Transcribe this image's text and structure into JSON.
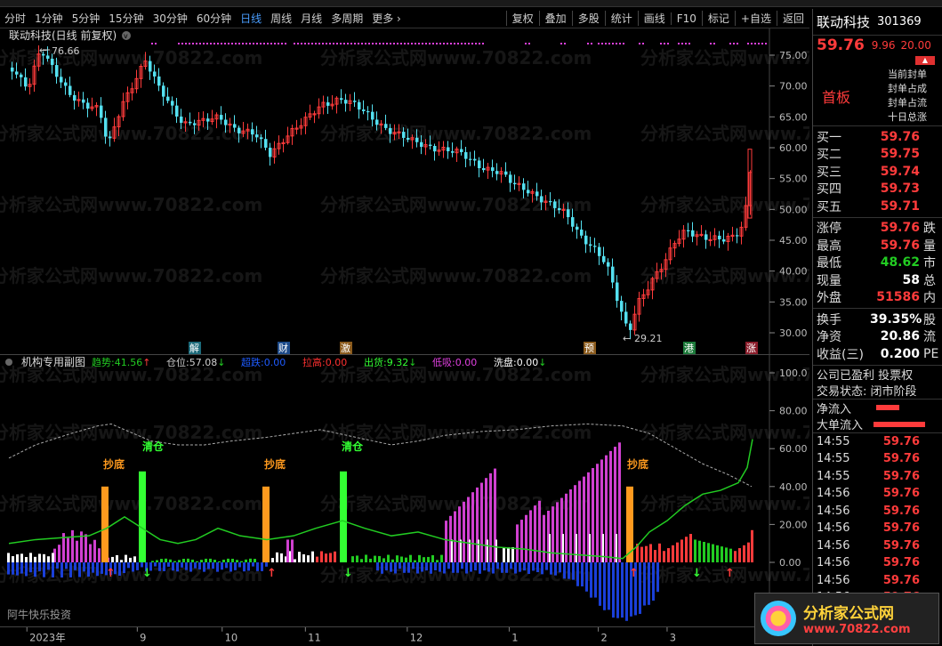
{
  "toolbar": {
    "tabs": [
      "分时",
      "1分钟",
      "5分钟",
      "15分钟",
      "30分钟",
      "60分钟",
      "日线",
      "周线",
      "月线",
      "多周期",
      "更多 ›"
    ],
    "active_tab": "日线",
    "right_buttons": [
      "复权",
      "叠加",
      "多股",
      "统计",
      "画线",
      "F10",
      "标记",
      "+自选",
      "返回"
    ]
  },
  "main_chart": {
    "title": "联动科技(日线 前复权)",
    "high_label": "76.66",
    "low_label": "29.21",
    "y_ticks": [
      "75.00",
      "70.00",
      "65.00",
      "60.00",
      "55.00",
      "50.00",
      "45.00",
      "40.00",
      "35.00",
      "30.00"
    ],
    "event_markers": [
      "解",
      "财",
      "激",
      "预",
      "港",
      "涨"
    ]
  },
  "sub_chart": {
    "title": "机构专用副图",
    "legend": [
      {
        "label": "趋势:",
        "value": "41.56",
        "arrow": "↑",
        "color": "#22cc22"
      },
      {
        "label": "仓位:",
        "value": "57.08",
        "arrow": "↓",
        "color": "#cfcfcf"
      },
      {
        "label": "超跌:",
        "value": "0.00",
        "arrow": "",
        "color": "#1e5bff"
      },
      {
        "label": "拉高:",
        "value": "0.00",
        "arrow": "",
        "color": "#ff3030"
      },
      {
        "label": "出货:",
        "value": "9.32",
        "arrow": "↓",
        "color": "#33ff33"
      },
      {
        "label": "低吸:",
        "value": "0.00",
        "arrow": "",
        "color": "#e040e0"
      },
      {
        "label": "洗盘:",
        "value": "0.00",
        "arrow": "↓",
        "color": "#ffffff"
      }
    ],
    "y_ticks": [
      "100.0",
      "80.00",
      "60.00",
      "40.00",
      "20.00",
      "0.00"
    ],
    "signals": [
      {
        "label": "抄底",
        "color": "#ff9a1e"
      },
      {
        "label": "清仓",
        "color": "#33ff33"
      },
      {
        "label": "抄底",
        "color": "#ff9a1e"
      },
      {
        "label": "清仓",
        "color": "#33ff33"
      },
      {
        "label": "抄底",
        "color": "#ff9a1e"
      }
    ],
    "footer_text": "阿牛快乐投资"
  },
  "x_axis": [
    "2023年",
    "9",
    "10",
    "11",
    "12",
    "1",
    "2",
    "3"
  ],
  "right_panel": {
    "stock_name": "联动科技",
    "stock_code": "301369",
    "price": "59.76",
    "change": "9.96",
    "change_pct": "20.00",
    "board_tag": "首板",
    "board_info": [
      "当前封单",
      "封单占成",
      "封单占流",
      "十日总涨"
    ],
    "bids": [
      {
        "label": "买一",
        "price": "59.76"
      },
      {
        "label": "买二",
        "price": "59.75"
      },
      {
        "label": "买三",
        "price": "59.74"
      },
      {
        "label": "买四",
        "price": "59.73"
      },
      {
        "label": "买五",
        "price": "59.71"
      }
    ],
    "stats": [
      {
        "label": "涨停",
        "value": "59.76",
        "color": "#ff3b3b",
        "tail": "跌"
      },
      {
        "label": "最高",
        "value": "59.76",
        "color": "#ff3b3b",
        "tail": "量"
      },
      {
        "label": "最低",
        "value": "48.62",
        "color": "#22cc22",
        "tail": "市"
      },
      {
        "label": "现量",
        "value": "58",
        "color": "#ffffff",
        "tail": "总"
      },
      {
        "label": "外盘",
        "value": "51586",
        "color": "#ff3b3b",
        "tail": "内"
      }
    ],
    "stats2": [
      {
        "label": "换手",
        "value": "39.35%",
        "tail": "股"
      },
      {
        "label": "净资",
        "value": "20.86",
        "tail": "流"
      },
      {
        "label": "收益(三)",
        "value": "0.200",
        "tail": "PE"
      }
    ],
    "company_info": "公司已盈利 投票权",
    "trade_status": "交易状态: 闭市阶段",
    "net_inflow": "净流入",
    "big_inflow": "大单流入",
    "ticks": [
      {
        "time": "14:55",
        "price": "59.76"
      },
      {
        "time": "14:55",
        "price": "59.76"
      },
      {
        "time": "14:55",
        "price": "59.76"
      },
      {
        "time": "14:56",
        "price": "59.76"
      },
      {
        "time": "14:56",
        "price": "59.76"
      },
      {
        "time": "14:56",
        "price": "59.76"
      },
      {
        "time": "14:56",
        "price": "59.76"
      },
      {
        "time": "14:56",
        "price": "59.76"
      },
      {
        "time": "14:56",
        "price": "59.76"
      },
      {
        "time": "14:56",
        "price": "59.76"
      }
    ]
  },
  "watermarks": [
    "分析家公式网www.70822.com"
  ],
  "logo": {
    "text": "分析家公式网",
    "url": "www.70822.com"
  }
}
